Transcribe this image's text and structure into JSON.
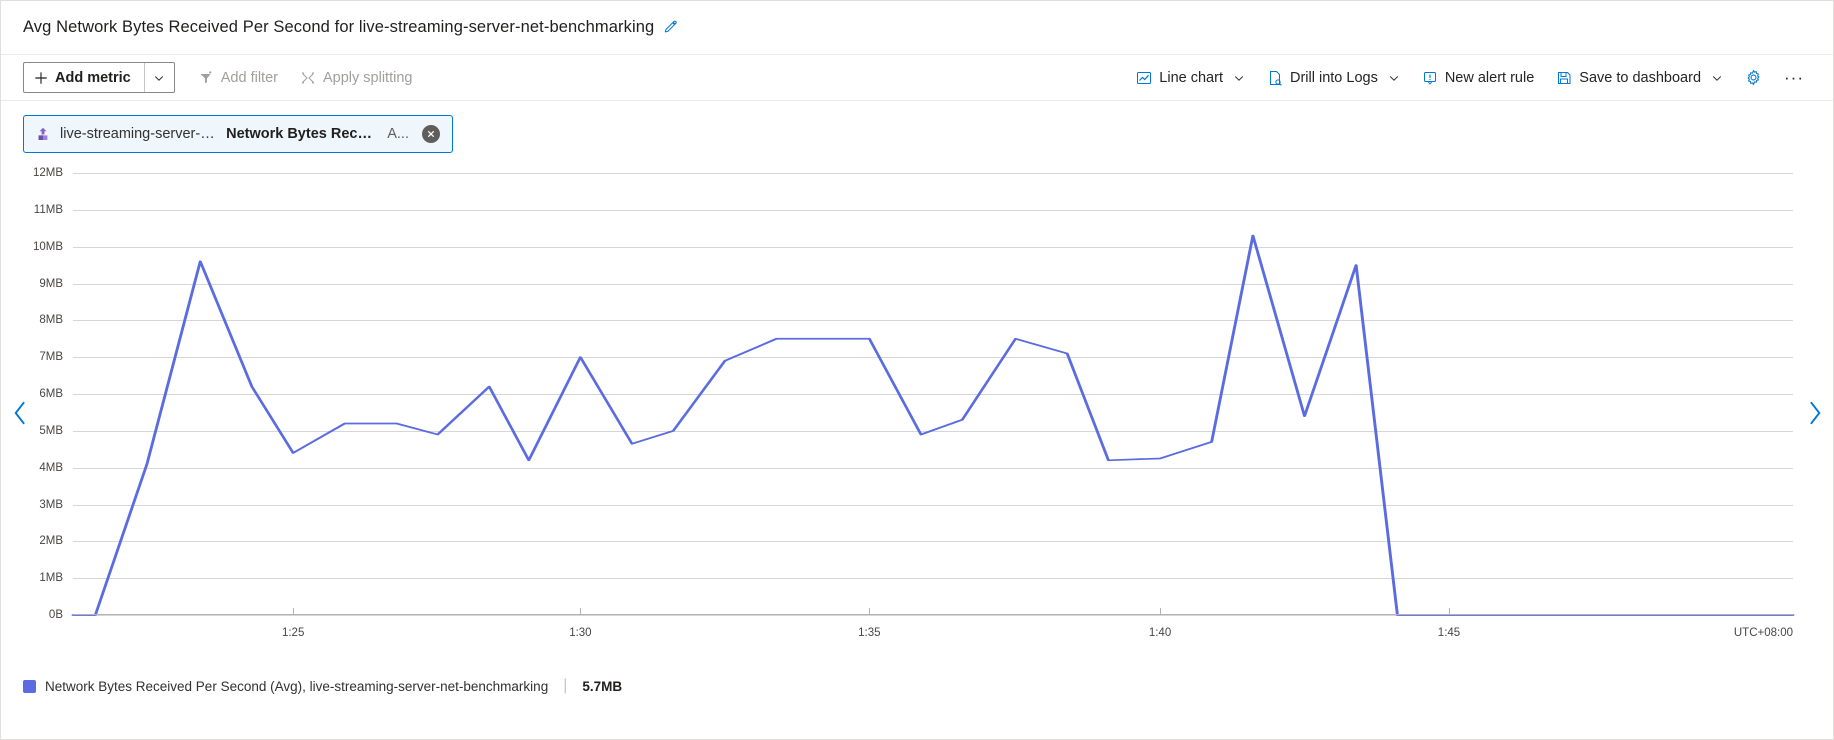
{
  "header": {
    "title": "Avg Network Bytes Received Per Second for live-streaming-server-net-benchmarking",
    "edit_icon": "pencil-icon"
  },
  "toolbar": {
    "add_metric_label": "Add metric",
    "add_metric_icon": "plus-icon",
    "add_metric_caret_icon": "chevron-down-icon",
    "add_filter_label": "Add filter",
    "add_filter_icon": "filter-icon",
    "apply_splitting_label": "Apply splitting",
    "apply_splitting_icon": "splitting-icon",
    "chart_type_label": "Line chart",
    "chart_type_icon": "line-chart-icon",
    "drill_logs_label": "Drill into Logs",
    "drill_logs_icon": "logs-icon",
    "new_alert_label": "New alert rule",
    "new_alert_icon": "alert-bell-icon",
    "save_dashboard_label": "Save to dashboard",
    "save_dashboard_icon": "save-icon",
    "settings_icon": "gear-icon",
    "more_label": "···"
  },
  "metric_chip": {
    "resource_icon": "azure-resource-icon",
    "resource": "live-streaming-server-net-...",
    "metric": "Network Bytes Receive...",
    "aggregation": "A...",
    "close_icon": "close-circle-icon"
  },
  "navigation": {
    "prev_icon": "chevron-left-icon",
    "next_icon": "chevron-right-icon"
  },
  "legend": {
    "swatch_color": "#5b6ce0",
    "label": "Network Bytes Received Per Second (Avg), live-streaming-server-net-benchmarking",
    "separator": "|",
    "value": "5.7MB"
  },
  "colors": {
    "series": "#5b6ce0",
    "accent": "#0078d4",
    "grid": "#d6d6d6",
    "axis": "#b3b3b3"
  },
  "chart_data": {
    "type": "line",
    "title": "Avg Network Bytes Received Per Second for live-streaming-server-net-benchmarking",
    "xlabel": "",
    "ylabel": "",
    "timezone": "UTC+08:00",
    "grid": true,
    "legend_position": "bottom-left",
    "ylim": [
      0,
      12
    ],
    "yunit": "MB",
    "ytick_labels": [
      "0B",
      "1MB",
      "2MB",
      "3MB",
      "4MB",
      "5MB",
      "6MB",
      "7MB",
      "8MB",
      "9MB",
      "10MB",
      "11MB",
      "12MB"
    ],
    "ytick_values": [
      0,
      1,
      2,
      3,
      4,
      5,
      6,
      7,
      8,
      9,
      10,
      11,
      12
    ],
    "xtick_labels": [
      "1:25",
      "1:30",
      "1:35",
      "1:40",
      "1:45"
    ],
    "xtick_positions": [
      0.128,
      0.295,
      0.463,
      0.632,
      0.8
    ],
    "series": [
      {
        "name": "Network Bytes Received Per Second (Avg), live-streaming-server-net-benchmarking",
        "color": "#5b6ce0",
        "current_value": "5.7MB",
        "x": [
          0.0,
          0.013,
          0.043,
          0.074,
          0.104,
          0.128,
          0.158,
          0.188,
          0.212,
          0.242,
          0.265,
          0.295,
          0.325,
          0.349,
          0.379,
          0.409,
          0.433,
          0.463,
          0.493,
          0.517,
          0.548,
          0.578,
          0.602,
          0.632,
          0.662,
          0.686,
          0.716,
          0.746,
          0.77,
          0.8,
          0.83,
          0.854,
          0.885,
          0.915,
          0.945,
          0.969,
          1.0
        ],
        "values": [
          0.0,
          0.0,
          4.1,
          9.6,
          6.2,
          4.4,
          5.2,
          5.2,
          4.9,
          6.2,
          4.2,
          7.0,
          4.65,
          5.0,
          6.9,
          7.5,
          7.5,
          7.5,
          4.9,
          5.3,
          7.5,
          7.1,
          4.2,
          4.25,
          4.7,
          10.3,
          5.4,
          9.5,
          0.0,
          0.0,
          0.0,
          0.0,
          0.0,
          0.0,
          0.0,
          0.0,
          0.0
        ]
      }
    ]
  }
}
